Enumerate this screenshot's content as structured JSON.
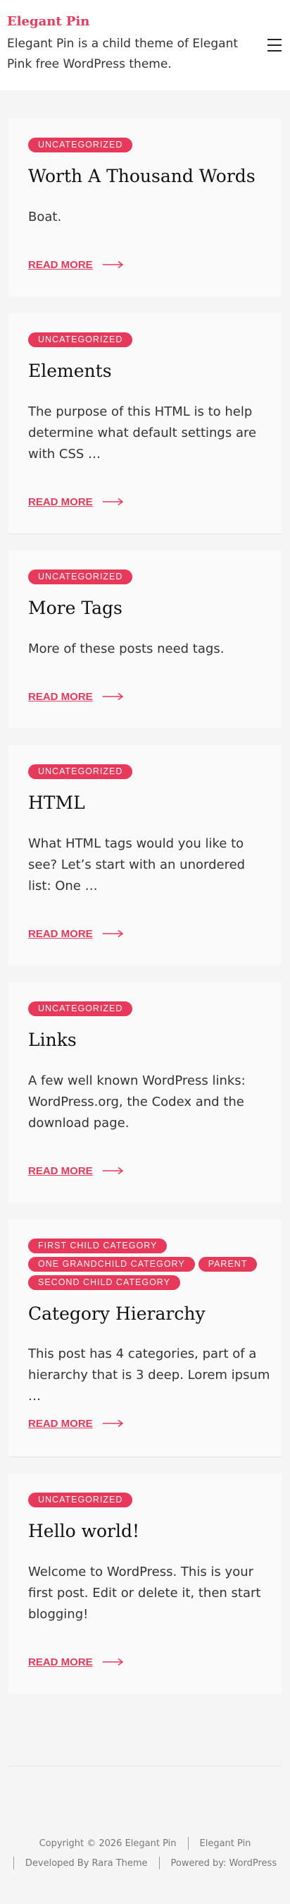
{
  "site": {
    "title": "Elegant Pin",
    "tagline": "Elegant Pin is a child theme of Elegant Pink free WordPress theme.",
    "menu_icon": "hamburger-menu-icon"
  },
  "posts": [
    {
      "categories": [
        "UNCATEGORIZED"
      ],
      "title": "Worth A Thousand Words",
      "excerpt": "Boat.",
      "read_more": "READ MORE"
    },
    {
      "categories": [
        "UNCATEGORIZED"
      ],
      "title": "Elements",
      "excerpt": "The purpose of this HTML is to help determine what default settings are with CSS …",
      "read_more": "READ MORE"
    },
    {
      "categories": [
        "UNCATEGORIZED"
      ],
      "title": "More Tags",
      "excerpt": "More of these posts need tags.",
      "read_more": "READ MORE"
    },
    {
      "categories": [
        "UNCATEGORIZED"
      ],
      "title": "HTML",
      "excerpt": "What HTML tags would you like to see? Let’s start with an unordered list: One …",
      "read_more": "READ MORE"
    },
    {
      "categories": [
        "UNCATEGORIZED"
      ],
      "title": "Links",
      "excerpt": "A few well known WordPress links: WordPress.org, the Codex and the download page.",
      "read_more": "READ MORE"
    },
    {
      "categories": [
        "FIRST CHILD CATEGORY",
        "ONE GRANDCHILD CATEGORY",
        "PARENT",
        "SECOND CHILD CATEGORY"
      ],
      "title": "Category Hierarchy",
      "excerpt": "This post has 4 categories, part of a hierarchy that is 3 deep. Lorem ipsum …",
      "read_more": "READ MORE"
    },
    {
      "categories": [
        "UNCATEGORIZED"
      ],
      "title": "Hello world!",
      "excerpt": "Welcome to WordPress. This is your first post. Edit or delete it, then start blogging!",
      "read_more": "READ MORE"
    }
  ],
  "footer": {
    "copyright": "Copyright © 2026 Elegant Pin",
    "site_link": "Elegant Pin",
    "developed_by": "Developed By Rara Theme",
    "powered_by": "Powered by: WordPress"
  },
  "colors": {
    "accent": "#e8395a",
    "background": "#f5f5f5",
    "card": "#fafafa"
  }
}
